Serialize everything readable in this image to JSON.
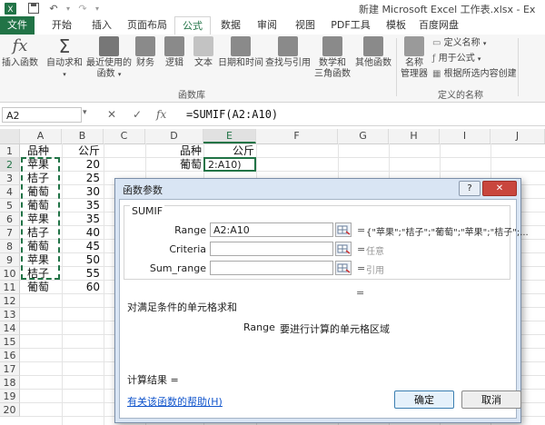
{
  "window": {
    "title": "新建 Microsoft Excel 工作表.xlsx - Ex"
  },
  "quick_access": {
    "save_icon": "save-icon",
    "undo_icon": "undo-icon",
    "redo_icon": "redo-icon"
  },
  "tabs": [
    {
      "label": "文件"
    },
    {
      "label": "开始"
    },
    {
      "label": "插入"
    },
    {
      "label": "页面布局"
    },
    {
      "label": "公式"
    },
    {
      "label": "数据"
    },
    {
      "label": "审阅"
    },
    {
      "label": "视图"
    },
    {
      "label": "PDF工具"
    },
    {
      "label": "模板"
    },
    {
      "label": "百度网盘"
    }
  ],
  "ribbon": {
    "insert_function": {
      "label": "插入函数",
      "glyph": "fx"
    },
    "autosum": {
      "label": "自动求和",
      "glyph": "Σ"
    },
    "recent": {
      "label_line1": "最近使用的",
      "label_line2": "函数"
    },
    "financial": {
      "label": "财务"
    },
    "logical": {
      "label": "逻辑"
    },
    "text": {
      "label": "文本"
    },
    "datetime": {
      "label": "日期和时间"
    },
    "lookup": {
      "label": "查找与引用"
    },
    "math": {
      "label_line1": "数学和",
      "label_line2": "三角函数"
    },
    "other": {
      "label": "其他函数"
    },
    "group_function_library": "函数库",
    "name_manager": {
      "label_line1": "名称",
      "label_line2": "管理器"
    },
    "define_name": {
      "label": "定义名称"
    },
    "use_in_formula": {
      "label": "用于公式"
    },
    "create_from_selection": {
      "label": "根据所选内容创建"
    },
    "group_defined_names": "定义的名称"
  },
  "formula_bar": {
    "name_box": "A2",
    "cancel_glyph": "✕",
    "enter_glyph": "✓",
    "fx_glyph": "fx",
    "formula": "=SUMIF(A2:A10)"
  },
  "sheet": {
    "columns": [
      "A",
      "B",
      "C",
      "D",
      "E",
      "F",
      "G",
      "H",
      "I",
      "J"
    ],
    "rows": [
      "1",
      "2",
      "3",
      "4",
      "5",
      "6",
      "7",
      "8",
      "9",
      "10",
      "11",
      "12",
      "13",
      "14",
      "15",
      "16",
      "17",
      "18",
      "19",
      "20"
    ],
    "colA": [
      "品种",
      "苹果",
      "桔子",
      "葡萄",
      "葡萄",
      "苹果",
      "桔子",
      "葡萄",
      "苹果",
      "桔子",
      "葡萄"
    ],
    "colB": [
      "公斤",
      "20",
      "25",
      "30",
      "35",
      "35",
      "40",
      "45",
      "50",
      "55",
      "60"
    ],
    "D1": "品种",
    "E1": "公斤",
    "D2": "葡萄",
    "E2": "2:A10)"
  },
  "dialog": {
    "title": "函数参数",
    "help_button": "?",
    "close_button": "✕",
    "function_name": "SUMIF",
    "args": [
      {
        "label": "Range",
        "value": "A2:A10",
        "result": "{\"苹果\";\"桔子\";\"葡萄\";\"苹果\";\"桔子\";..."
      },
      {
        "label": "Criteria",
        "value": "",
        "result": "任意"
      },
      {
        "label": "Sum_range",
        "value": "",
        "result": "引用"
      }
    ],
    "eq": "=",
    "description": "对满足条件的单元格求和",
    "arg_help_name": "Range",
    "arg_help_text": "要进行计算的单元格区域",
    "result_label": "计算结果 =",
    "help_link": "有关该函数的帮助(H)",
    "ok": "确定",
    "cancel": "取消"
  },
  "colors": {
    "accent": "#217346",
    "dialog_bg": "#d9e5f4"
  }
}
